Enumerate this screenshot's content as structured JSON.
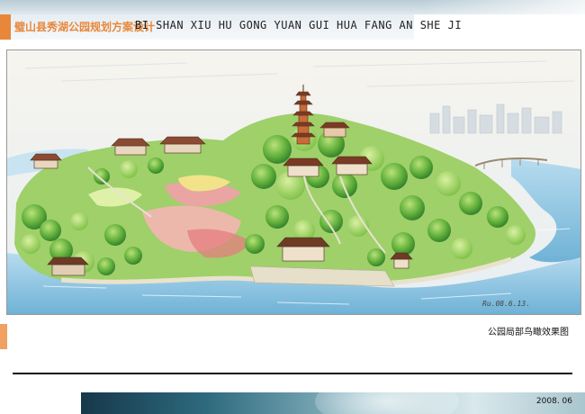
{
  "header": {
    "title_cn": "璧山县秀湖公园规划方案设计",
    "title_pinyin": "BI SHAN XIU HU GONG YUAN GUI HUA FANG AN SHE JI"
  },
  "drawing": {
    "signature": "Ru.08.6.13."
  },
  "caption": "公园局部鸟瞰效果图",
  "footer": {
    "date": "2008. 06"
  },
  "colors": {
    "accent_orange": "#e8873a",
    "water_blue": "#8ec3e0",
    "foliage_green": "#5fae3a"
  }
}
